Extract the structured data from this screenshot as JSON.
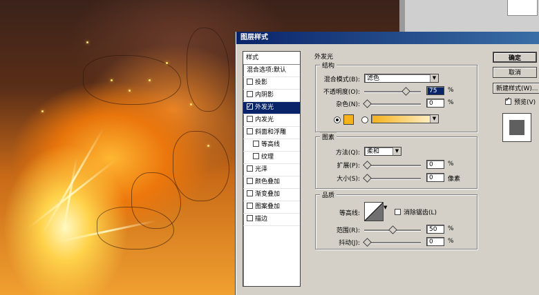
{
  "dialog": {
    "title": "图层样式",
    "style_list": {
      "header": "样式",
      "items": [
        {
          "label": "混合选项:默认",
          "checkbox": false,
          "checked": false,
          "indent": false,
          "selected": false
        },
        {
          "label": "投影",
          "checkbox": true,
          "checked": false,
          "indent": false,
          "selected": false
        },
        {
          "label": "内阴影",
          "checkbox": true,
          "checked": false,
          "indent": false,
          "selected": false
        },
        {
          "label": "外发光",
          "checkbox": true,
          "checked": true,
          "indent": false,
          "selected": true
        },
        {
          "label": "内发光",
          "checkbox": true,
          "checked": false,
          "indent": false,
          "selected": false
        },
        {
          "label": "斜面和浮雕",
          "checkbox": true,
          "checked": false,
          "indent": false,
          "selected": false
        },
        {
          "label": "等高线",
          "checkbox": true,
          "checked": false,
          "indent": true,
          "selected": false
        },
        {
          "label": "纹理",
          "checkbox": true,
          "checked": false,
          "indent": true,
          "selected": false
        },
        {
          "label": "光泽",
          "checkbox": true,
          "checked": false,
          "indent": false,
          "selected": false
        },
        {
          "label": "颜色叠加",
          "checkbox": true,
          "checked": false,
          "indent": false,
          "selected": false
        },
        {
          "label": "渐变叠加",
          "checkbox": true,
          "checked": false,
          "indent": false,
          "selected": false
        },
        {
          "label": "图案叠加",
          "checkbox": true,
          "checked": false,
          "indent": false,
          "selected": false
        },
        {
          "label": "描边",
          "checkbox": true,
          "checked": false,
          "indent": false,
          "selected": false
        }
      ]
    },
    "outer_glow": {
      "title": "外发光",
      "structure": {
        "title": "结构",
        "blend_mode_label": "混合模式(B):",
        "blend_mode_value": "滤色",
        "opacity_label": "不透明度(O):",
        "opacity_value": "75",
        "opacity_fraction": 0.75,
        "noise_label": "杂色(N):",
        "noise_value": "0",
        "noise_fraction": 0.0,
        "percent": "%",
        "color": "#f5b21c",
        "gradient_start": "#f5b21c",
        "gradient_end": "#fff4d8"
      },
      "elements": {
        "title": "图素",
        "technique_label": "方法(Q):",
        "technique_value": "柔和",
        "spread_label": "扩展(P):",
        "spread_value": "0",
        "spread_fraction": 0.0,
        "size_label": "大小(S):",
        "size_value": "0",
        "size_fraction": 0.0,
        "percent": "%",
        "pixels": "像素"
      },
      "quality": {
        "title": "品质",
        "contour_label": "等高线:",
        "anti_alias_label": "消除锯齿(L)",
        "range_label": "范围(R):",
        "range_value": "50",
        "range_fraction": 0.5,
        "jitter_label": "抖动(J):",
        "jitter_value": "0",
        "jitter_fraction": 0.0,
        "percent": "%"
      }
    },
    "buttons": {
      "ok": "确定",
      "cancel": "取消",
      "new_style": "新建样式(W)...",
      "preview_label": "预览(V)"
    }
  }
}
